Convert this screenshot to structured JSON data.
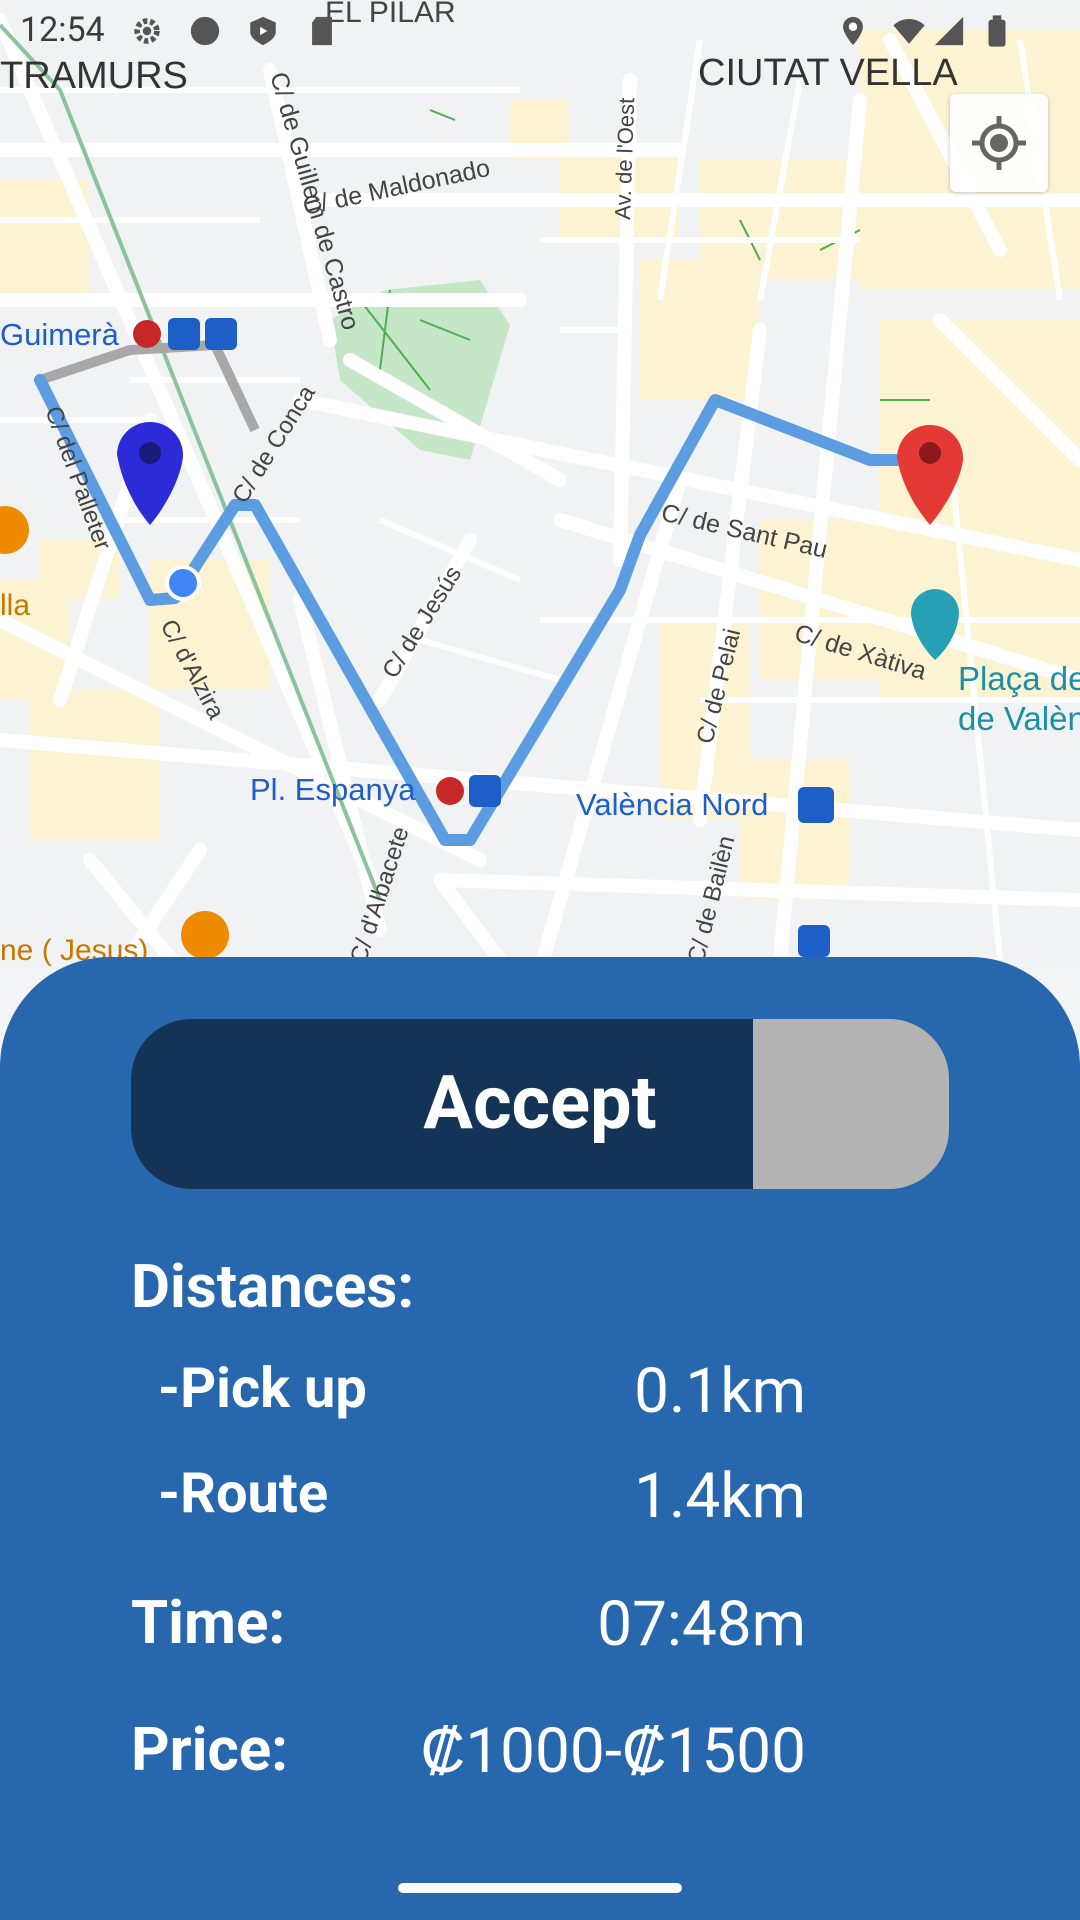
{
  "status_bar": {
    "time": "12:54"
  },
  "map": {
    "districts": [
      "EL PILAR",
      "TRAMURS",
      "CIUTAT VELLA"
    ],
    "streets": [
      "C/ de Guillem de Castro",
      "C/ de Maldonado",
      "Av. de l'Oest",
      "C/ del Palleter",
      "C/ de Conca",
      "C/ d'Alzira",
      "C/ de Jesús",
      "C/ de Sant Pau",
      "C/ de Xàtiva",
      "C/ de Pelai",
      "C/ de Bailèn",
      "C/ d'Albacete"
    ],
    "places": [
      "Guimerà",
      "Pl. Espanya",
      "València Nord",
      "Plaça de",
      "de Valèn",
      "lla",
      "ne ( Jesus)"
    ]
  },
  "panel": {
    "accept_label": "Accept",
    "accept_progress": 0.76,
    "distances_heading": "Distances:",
    "pickup_label": "-Pick up",
    "pickup_value": "0.1km",
    "route_label": "-Route",
    "route_value": "1.4km",
    "time_label": "Time:",
    "time_value": "07:48m",
    "price_label": "Price:",
    "price_value": "₡1000-₡1500"
  },
  "colors": {
    "panel": "#2767ae",
    "slider_track": "#143457",
    "slider_thumb": "#b3b3b3",
    "route": "#5b9de0",
    "pickup_pin": "#2b2bd8",
    "dest_pin": "#e53935"
  }
}
